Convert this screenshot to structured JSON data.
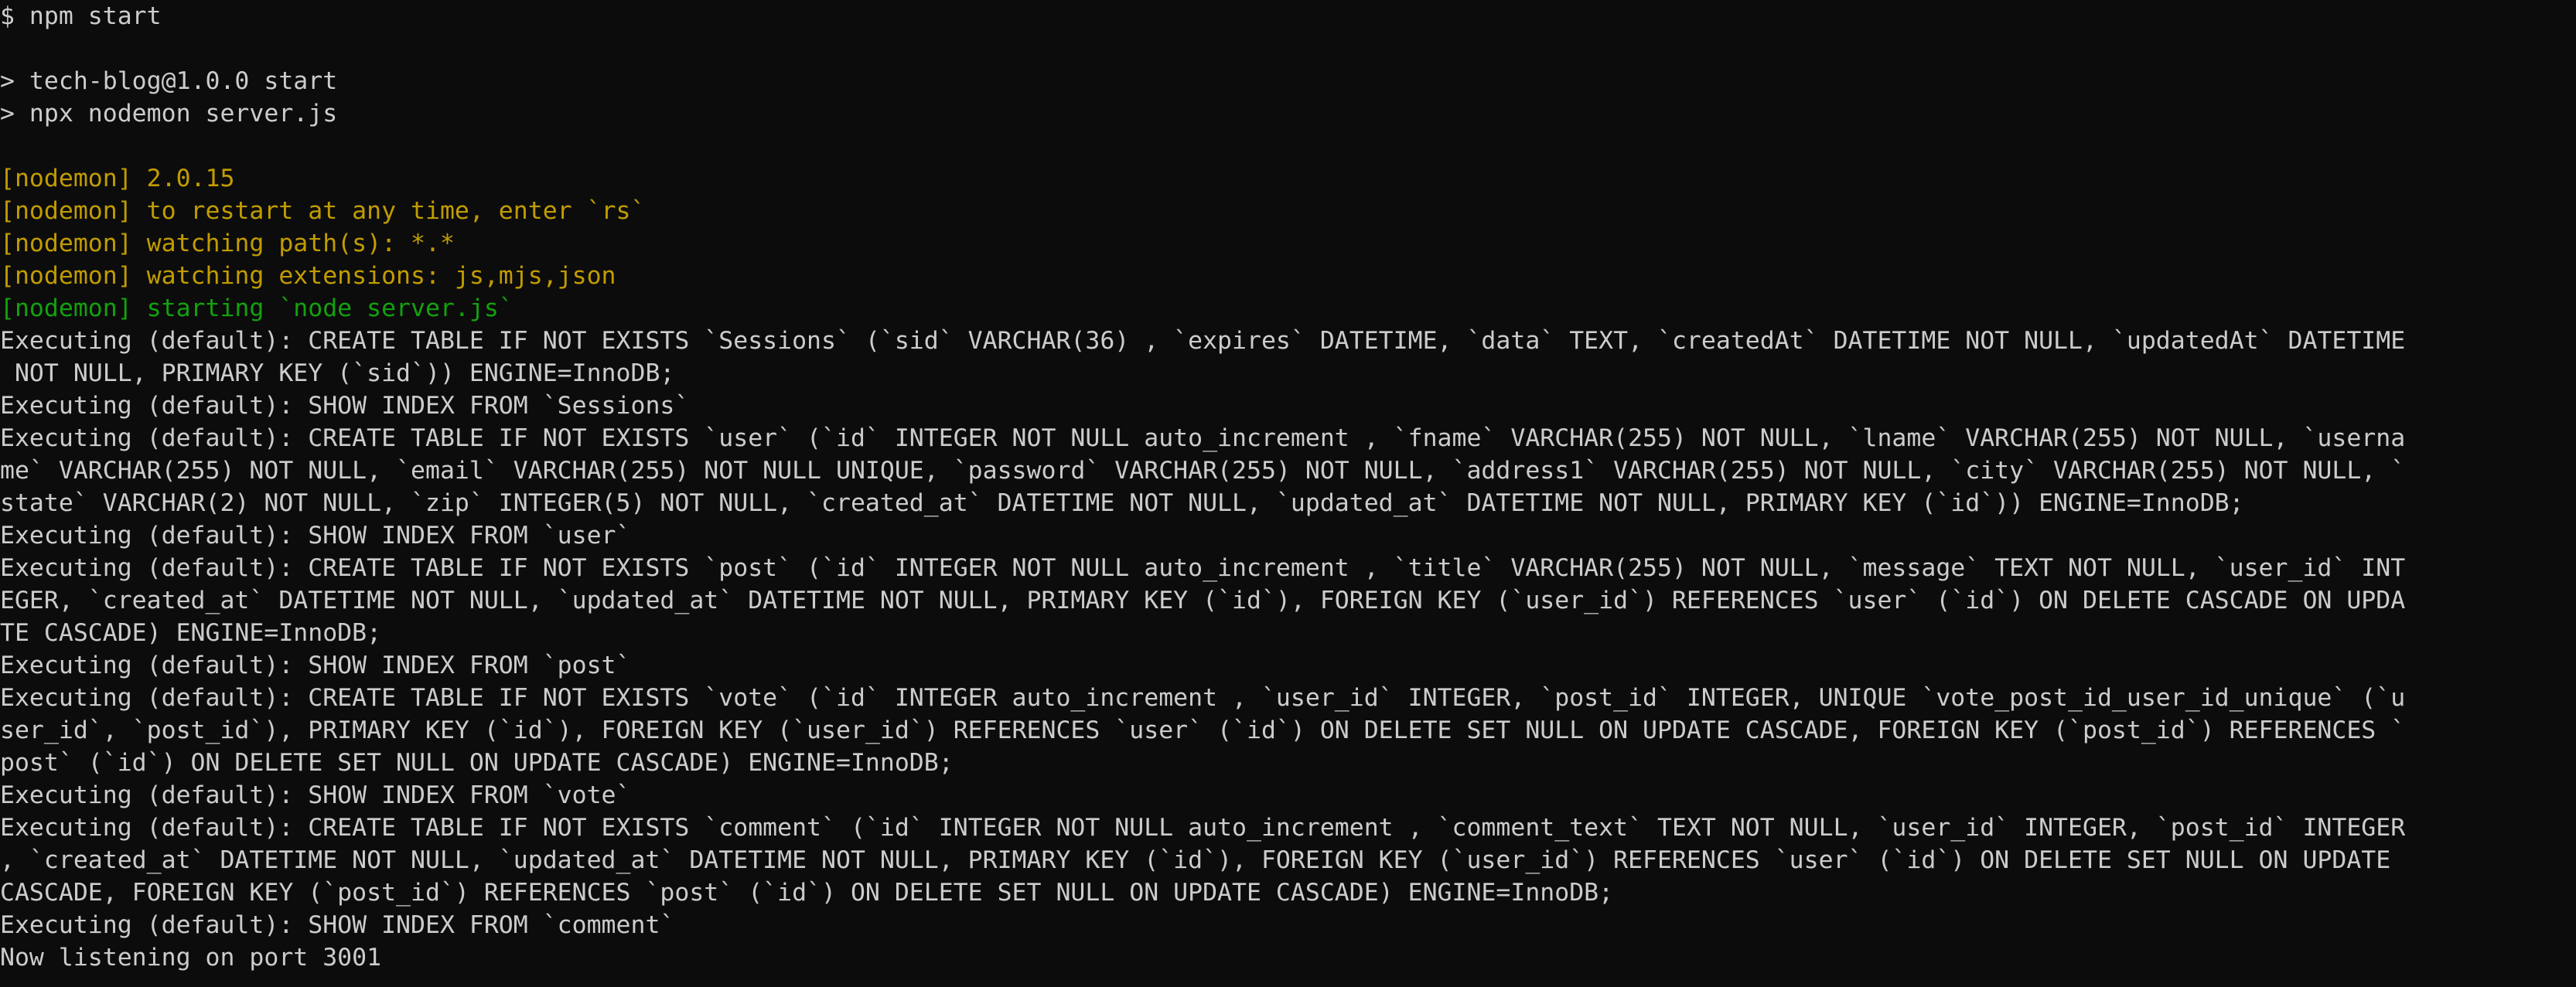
{
  "colors": {
    "background": "#0c0c0c",
    "default_text": "#cccccc",
    "nodemon_yellow": "#c19c00",
    "nodemon_green": "#13a10e"
  },
  "lines": [
    {
      "text": "$ npm start",
      "color": "white"
    },
    {
      "text": "",
      "color": "white"
    },
    {
      "text": "> tech-blog@1.0.0 start",
      "color": "white"
    },
    {
      "text": "> npx nodemon server.js",
      "color": "white"
    },
    {
      "text": "",
      "color": "white"
    },
    {
      "text": "[nodemon] 2.0.15",
      "color": "yellow"
    },
    {
      "text": "[nodemon] to restart at any time, enter `rs`",
      "color": "yellow"
    },
    {
      "text": "[nodemon] watching path(s): *.*",
      "color": "yellow"
    },
    {
      "text": "[nodemon] watching extensions: js,mjs,json",
      "color": "yellow"
    },
    {
      "text": "[nodemon] starting `node server.js`",
      "color": "green"
    },
    {
      "text": "Executing (default): CREATE TABLE IF NOT EXISTS `Sessions` (`sid` VARCHAR(36) , `expires` DATETIME, `data` TEXT, `createdAt` DATETIME NOT NULL, `updatedAt` DATETIME",
      "color": "white"
    },
    {
      "text": " NOT NULL, PRIMARY KEY (`sid`)) ENGINE=InnoDB;",
      "color": "white"
    },
    {
      "text": "Executing (default): SHOW INDEX FROM `Sessions`",
      "color": "white"
    },
    {
      "text": "Executing (default): CREATE TABLE IF NOT EXISTS `user` (`id` INTEGER NOT NULL auto_increment , `fname` VARCHAR(255) NOT NULL, `lname` VARCHAR(255) NOT NULL, `userna",
      "color": "white"
    },
    {
      "text": "me` VARCHAR(255) NOT NULL, `email` VARCHAR(255) NOT NULL UNIQUE, `password` VARCHAR(255) NOT NULL, `address1` VARCHAR(255) NOT NULL, `city` VARCHAR(255) NOT NULL, `",
      "color": "white"
    },
    {
      "text": "state` VARCHAR(2) NOT NULL, `zip` INTEGER(5) NOT NULL, `created_at` DATETIME NOT NULL, `updated_at` DATETIME NOT NULL, PRIMARY KEY (`id`)) ENGINE=InnoDB;",
      "color": "white"
    },
    {
      "text": "Executing (default): SHOW INDEX FROM `user`",
      "color": "white"
    },
    {
      "text": "Executing (default): CREATE TABLE IF NOT EXISTS `post` (`id` INTEGER NOT NULL auto_increment , `title` VARCHAR(255) NOT NULL, `message` TEXT NOT NULL, `user_id` INT",
      "color": "white"
    },
    {
      "text": "EGER, `created_at` DATETIME NOT NULL, `updated_at` DATETIME NOT NULL, PRIMARY KEY (`id`), FOREIGN KEY (`user_id`) REFERENCES `user` (`id`) ON DELETE CASCADE ON UPDA",
      "color": "white"
    },
    {
      "text": "TE CASCADE) ENGINE=InnoDB;",
      "color": "white"
    },
    {
      "text": "Executing (default): SHOW INDEX FROM `post`",
      "color": "white"
    },
    {
      "text": "Executing (default): CREATE TABLE IF NOT EXISTS `vote` (`id` INTEGER auto_increment , `user_id` INTEGER, `post_id` INTEGER, UNIQUE `vote_post_id_user_id_unique` (`u",
      "color": "white"
    },
    {
      "text": "ser_id`, `post_id`), PRIMARY KEY (`id`), FOREIGN KEY (`user_id`) REFERENCES `user` (`id`) ON DELETE SET NULL ON UPDATE CASCADE, FOREIGN KEY (`post_id`) REFERENCES `",
      "color": "white"
    },
    {
      "text": "post` (`id`) ON DELETE SET NULL ON UPDATE CASCADE) ENGINE=InnoDB;",
      "color": "white"
    },
    {
      "text": "Executing (default): SHOW INDEX FROM `vote`",
      "color": "white"
    },
    {
      "text": "Executing (default): CREATE TABLE IF NOT EXISTS `comment` (`id` INTEGER NOT NULL auto_increment , `comment_text` TEXT NOT NULL, `user_id` INTEGER, `post_id` INTEGER",
      "color": "white"
    },
    {
      "text": ", `created_at` DATETIME NOT NULL, `updated_at` DATETIME NOT NULL, PRIMARY KEY (`id`), FOREIGN KEY (`user_id`) REFERENCES `user` (`id`) ON DELETE SET NULL ON UPDATE",
      "color": "white"
    },
    {
      "text": "CASCADE, FOREIGN KEY (`post_id`) REFERENCES `post` (`id`) ON DELETE SET NULL ON UPDATE CASCADE) ENGINE=InnoDB;",
      "color": "white"
    },
    {
      "text": "Executing (default): SHOW INDEX FROM `comment`",
      "color": "white"
    },
    {
      "text": "Now listening on port 3001",
      "color": "white"
    }
  ]
}
